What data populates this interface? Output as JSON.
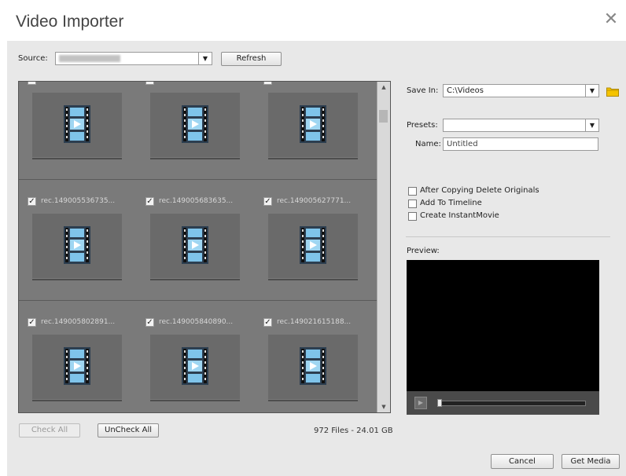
{
  "window": {
    "title": "Video Importer",
    "close_glyph": "✕"
  },
  "source": {
    "label": "Source:",
    "value_blurred": true,
    "refresh_label": "Refresh"
  },
  "grid": {
    "rows": [
      {
        "items": [
          {
            "label": "",
            "checked": true
          },
          {
            "label": "",
            "checked": true
          },
          {
            "label": "",
            "checked": true
          }
        ]
      },
      {
        "items": [
          {
            "label": "rec.149005536735...",
            "checked": true
          },
          {
            "label": "rec.149005683635...",
            "checked": true
          },
          {
            "label": "rec.149005627771...",
            "checked": true
          }
        ]
      },
      {
        "items": [
          {
            "label": "rec.149005802891...",
            "checked": true
          },
          {
            "label": "rec.149005840890...",
            "checked": true
          },
          {
            "label": "rec.149021615188...",
            "checked": true
          }
        ]
      }
    ],
    "check_all_label": "Check All",
    "uncheck_all_label": "UnCheck All",
    "summary": "972 Files - 24.01 GB"
  },
  "save": {
    "save_in_label": "Save In:",
    "save_in_value": "C:\\Videos",
    "presets_label": "Presets:",
    "presets_value": "",
    "name_label": "Name:",
    "name_value": "Untitled"
  },
  "options": [
    {
      "label": "After Copying Delete Originals",
      "checked": false
    },
    {
      "label": "Add To Timeline",
      "checked": false
    },
    {
      "label": "Create InstantMovie",
      "checked": false
    }
  ],
  "preview": {
    "label": "Preview:",
    "progress": 0
  },
  "footer": {
    "cancel_label": "Cancel",
    "get_media_label": "Get Media"
  },
  "icons": {
    "folder": "folder-icon",
    "film": "video-file-icon",
    "play": "play-icon"
  },
  "colors": {
    "folder_accent": "#f5c400",
    "grid_bg": "#7a7a7a",
    "film_blue": "#7fc4ea"
  }
}
